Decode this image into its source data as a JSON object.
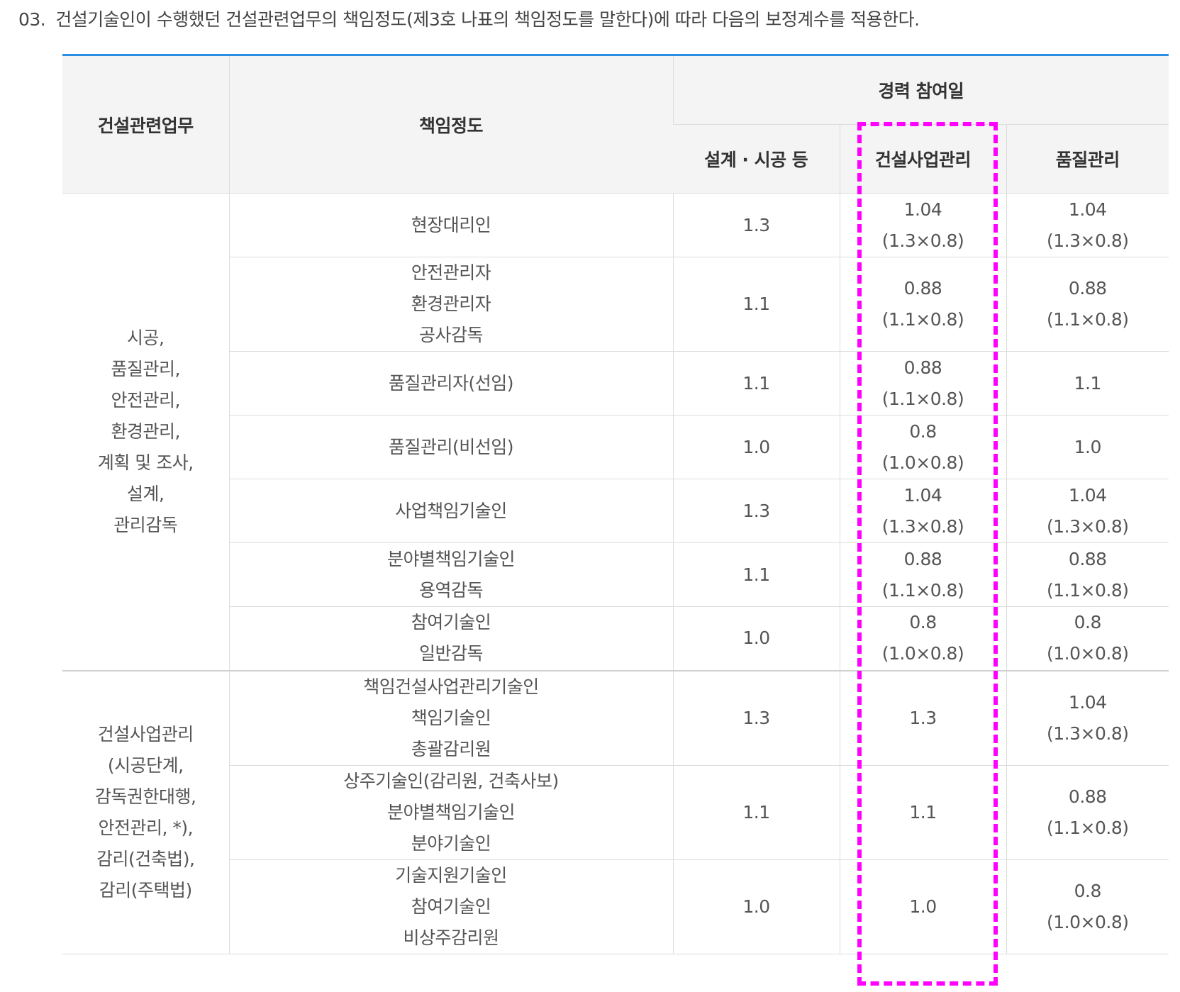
{
  "intro": {
    "number": "03.",
    "text": "건설기술인이 수행했던 건설관련업무의 책임정도(제3호 나표의 책임정도를 말한다)에 따라 다음의 보정계수를 적용한다."
  },
  "table": {
    "headers": {
      "work": "건설관련업무",
      "responsibility": "책임정도",
      "career_days": "경력 참여일",
      "design": "설계 · 시공 등",
      "cm": "건설사업관리",
      "quality": "품질관리"
    },
    "groups": [
      {
        "work_lines": [
          "시공,",
          "품질관리,",
          "안전관리,",
          "환경관리,",
          "계획 및 조사,",
          "설계,",
          "관리감독"
        ],
        "rows": [
          {
            "resp": [
              "현장대리인"
            ],
            "design": "1.3",
            "cm": [
              "1.04",
              "(1.3×0.8)"
            ],
            "quality": [
              "1.04",
              "(1.3×0.8)"
            ]
          },
          {
            "resp": [
              "안전관리자",
              "환경관리자",
              "공사감독"
            ],
            "design": "1.1",
            "cm": [
              "0.88",
              "(1.1×0.8)"
            ],
            "quality": [
              "0.88",
              "(1.1×0.8)"
            ]
          },
          {
            "resp": [
              "품질관리자(선임)"
            ],
            "design": "1.1",
            "cm": [
              "0.88",
              "(1.1×0.8)"
            ],
            "quality": [
              "1.1"
            ]
          },
          {
            "resp": [
              "품질관리(비선임)"
            ],
            "design": "1.0",
            "cm": [
              "0.8",
              "(1.0×0.8)"
            ],
            "quality": [
              "1.0"
            ]
          },
          {
            "resp": [
              "사업책임기술인"
            ],
            "design": "1.3",
            "cm": [
              "1.04",
              "(1.3×0.8)"
            ],
            "quality": [
              "1.04",
              "(1.3×0.8)"
            ]
          },
          {
            "resp": [
              "분야별책임기술인",
              "용역감독"
            ],
            "design": "1.1",
            "cm": [
              "0.88",
              "(1.1×0.8)"
            ],
            "quality": [
              "0.88",
              "(1.1×0.8)"
            ]
          },
          {
            "resp": [
              "참여기술인",
              "일반감독"
            ],
            "design": "1.0",
            "cm": [
              "0.8",
              "(1.0×0.8)"
            ],
            "quality": [
              "0.8",
              "(1.0×0.8)"
            ]
          }
        ]
      },
      {
        "work_lines": [
          "건설사업관리",
          "(시공단계,",
          "감독권한대행,",
          "안전관리, *),",
          "감리(건축법),",
          "감리(주택법)"
        ],
        "rows": [
          {
            "resp": [
              "책임건설사업관리기술인",
              "책임기술인",
              "총괄감리원"
            ],
            "design": "1.3",
            "cm": [
              "1.3"
            ],
            "quality": [
              "1.04",
              "(1.3×0.8)"
            ]
          },
          {
            "resp": [
              "상주기술인(감리원, 건축사보)",
              "분야별책임기술인",
              "분야기술인"
            ],
            "design": "1.1",
            "cm": [
              "1.1"
            ],
            "quality": [
              "0.88",
              "(1.1×0.8)"
            ]
          },
          {
            "resp": [
              "기술지원기술인",
              "참여기술인",
              "비상주감리원"
            ],
            "design": "1.0",
            "cm": [
              "1.0"
            ],
            "quality": [
              "0.8",
              "(1.0×0.8)"
            ]
          }
        ]
      }
    ]
  },
  "highlight_color": "#ff00ff",
  "header_rule_color": "#2a8fe0"
}
